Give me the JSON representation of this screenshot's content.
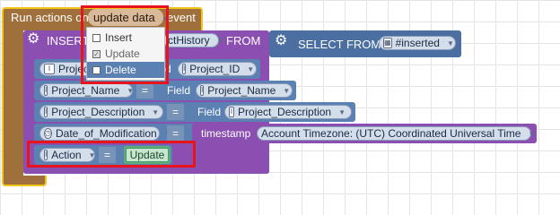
{
  "event_block": {
    "prefix": "Run actions on",
    "dropdown_value": "update data",
    "suffix": "event"
  },
  "insert_block": {
    "keyword": "INSERT",
    "table_pill": "ctHistory",
    "from_label": "FROM"
  },
  "select_block": {
    "keyword": "SELECT FROM",
    "source_pill": "#inserted"
  },
  "rows": [
    {
      "name_pill": "Project",
      "field_label": "d",
      "value_pill": "Project_ID"
    },
    {
      "name_pill": "Project_Name",
      "eq": "=",
      "field_label": "Field",
      "value_pill": "Project_Name"
    },
    {
      "name_pill": "Project_Description",
      "eq": "=",
      "field_label": "Field",
      "value_pill": "Project_Description"
    },
    {
      "name_pill": "Date_of_Modification",
      "eq": "=",
      "field_label": "timestamp",
      "value_pill": "Account Timezone: (UTC) Coordinated Universal Time"
    },
    {
      "name_pill": "Action",
      "eq": "=",
      "value_pill": "Update"
    }
  ],
  "dropdown_menu": {
    "items": [
      {
        "label": "Insert",
        "checked": false
      },
      {
        "label": "Update",
        "checked": true
      },
      {
        "label": "Delete",
        "checked": false,
        "highlighted": true
      }
    ]
  },
  "colors": {
    "event_block": "#a0703c",
    "yellow_outline": "#f0c419",
    "insert_block": "#8a4fb0",
    "select_block": "#4a6fa0",
    "row_block": "#5b80b2",
    "highlight": "#e8141c",
    "update_value": "#5bad7a"
  }
}
